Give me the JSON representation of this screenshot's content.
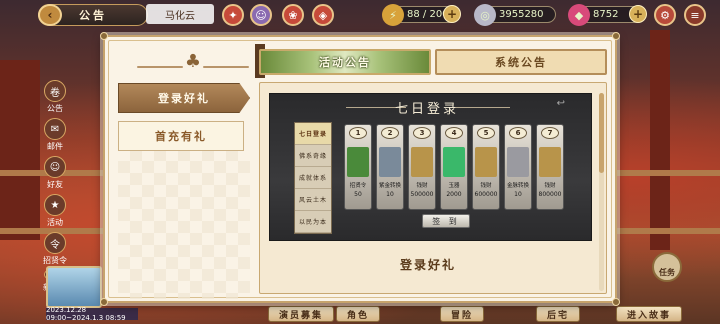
{
  "top_bar": {
    "title": "公告",
    "back_symbol": "‹",
    "npc_name": "马化云",
    "stamina": "88 / 200",
    "silver": "3955280",
    "gems": "8752"
  },
  "side_menu": [
    {
      "label": "公告",
      "icon": "scroll-icon"
    },
    {
      "label": "邮件",
      "icon": "mail-icon"
    },
    {
      "label": "好友",
      "icon": "friends-icon"
    },
    {
      "label": "活动",
      "icon": "event-icon"
    },
    {
      "label": "招贤令",
      "icon": "recruit-icon"
    },
    {
      "label": "新手任务",
      "icon": "quest-icon"
    }
  ],
  "bottom_nav": {
    "date_range": "2023.12.28 09:00~2024.1.3 08:59",
    "buttons": [
      "演员募集",
      "角色",
      "冒险",
      "后宅",
      "进入故事"
    ],
    "task_label": "任务"
  },
  "dialog": {
    "tabs": {
      "active_label": "活动公告",
      "inactive_label": "系统公告"
    },
    "list": [
      {
        "label": "登录好礼",
        "active": true
      },
      {
        "label": "首充有礼",
        "active": false
      }
    ],
    "banner": {
      "title": "七日登录",
      "sign_button": "签 到",
      "sidebar": [
        "七日登录",
        "佛系奇缘",
        "成就体系",
        "风云土木",
        "以民为本"
      ],
      "cards": [
        {
          "day": "1",
          "name": "招贤令",
          "qty": "50",
          "color": "#4a8a3a"
        },
        {
          "day": "2",
          "name": "紫金转换",
          "qty": "10",
          "color": "#7a8a9a"
        },
        {
          "day": "3",
          "name": "钱财",
          "qty": "500000",
          "color": "#b8944a"
        },
        {
          "day": "4",
          "name": "玉器",
          "qty": "2000",
          "color": "#3ab86a"
        },
        {
          "day": "5",
          "name": "钱财",
          "qty": "600000",
          "color": "#b8944a"
        },
        {
          "day": "6",
          "name": "金脉转换",
          "qty": "10",
          "color": "#9a9aa0"
        },
        {
          "day": "7",
          "name": "钱财",
          "qty": "800000",
          "color": "#b8944a"
        }
      ]
    },
    "content_heading": "登录好礼"
  },
  "colors": {
    "dialog_bg": "#faf3e6",
    "gold_border": "#c6a36c",
    "active_tab": "#a8c27a",
    "list_active": "#b2885a"
  }
}
